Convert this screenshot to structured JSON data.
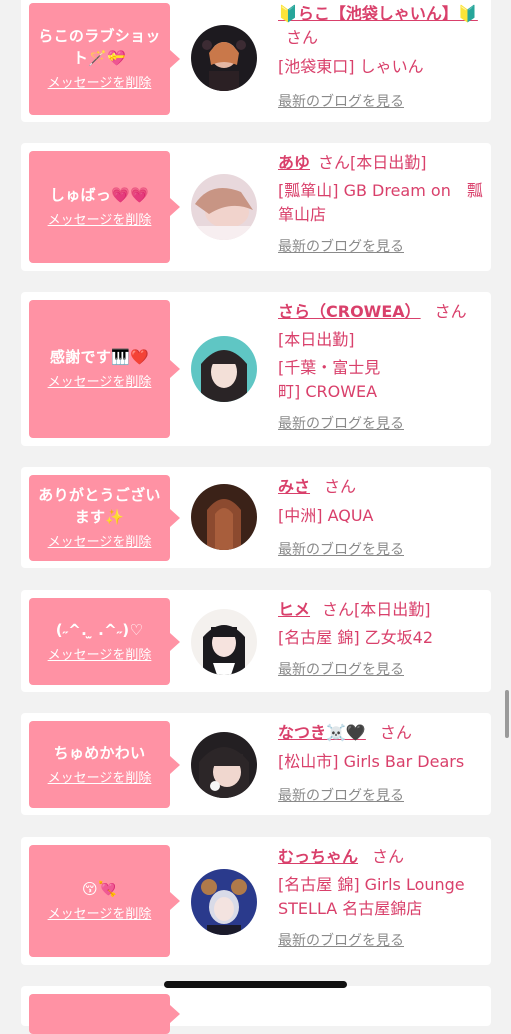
{
  "delete_label": "メッセージを削除",
  "blog_label": "最新のブログを見る",
  "honorific": "さん",
  "items": [
    {
      "message": "らこのラブショット🪄💝",
      "name": "🔰らこ【池袋しゃいん】🔰",
      "shop": "[池袋東口] しゃいん",
      "status": ""
    },
    {
      "message": "しゅばっ💗💗",
      "name": "あゆ",
      "status": "[本日出勤]",
      "shop": "[瓢箪山] GB Dream on　瓢箪山店"
    },
    {
      "message": "感謝です🎹❤️",
      "name": "さら（CROWEA）",
      "status": "[本日出勤]",
      "shop": "[千葉・富士見町] CROWEA"
    },
    {
      "message": "ありがとうございます✨",
      "name": "みさ",
      "status": "",
      "shop": "[中洲] AQUA"
    },
    {
      "message": "(˶^. ̫ .^˶)♡",
      "name": "ヒメ",
      "status": "[本日出勤]",
      "shop": "[名古屋 錦] 乙女坂42"
    },
    {
      "message": "ちゅめかわい",
      "name": "なつき☠️🖤",
      "status": "",
      "shop": "[松山市] Girls Bar Dears"
    },
    {
      "message": "😚💘",
      "name": "むっちゃん",
      "status": "",
      "shop": "[名古屋 錦] Girls Lounge STELLA 名古屋錦店"
    }
  ],
  "colors": {
    "bubble": "#ff92a4",
    "accent": "#d9406b",
    "link_gray": "#8a8a8a",
    "background": "#f2f2f2"
  }
}
